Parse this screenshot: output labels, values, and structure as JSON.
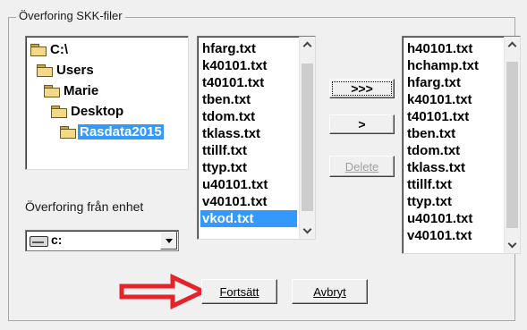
{
  "group": {
    "title": "Överforing SKK-filer"
  },
  "tree": {
    "items": [
      {
        "label": "C:\\",
        "icon": "folder-open-icon"
      },
      {
        "label": "Users",
        "icon": "folder-open-icon"
      },
      {
        "label": "Marie",
        "icon": "folder-open-icon"
      },
      {
        "label": "Desktop",
        "icon": "folder-open-icon"
      },
      {
        "label": "Rasdata2015",
        "icon": "folder-open-icon",
        "selected": true
      }
    ]
  },
  "source_list": {
    "items": [
      "hfarg.txt",
      "k40101.txt",
      "t40101.txt",
      "tben.txt",
      "tdom.txt",
      "tklass.txt",
      "ttillf.txt",
      "ttyp.txt",
      "u40101.txt",
      "v40101.txt",
      "vkod.txt"
    ],
    "selected": "vkod.txt"
  },
  "buttons": {
    "copy_all_label": ">>>",
    "copy_one_label": ">",
    "delete_label": "Delete",
    "continue_label": "Fortsätt",
    "cancel_label": "Avbryt"
  },
  "target_list": {
    "items": [
      "h40101.txt",
      "hchamp.txt",
      "hfarg.txt",
      "k40101.txt",
      "t40101.txt",
      "tben.txt",
      "tdom.txt",
      "tklass.txt",
      "ttillf.txt",
      "ttyp.txt",
      "u40101.txt",
      "v40101.txt"
    ]
  },
  "drive": {
    "label": "Överforing från enhet",
    "value": "c:",
    "icon": "drive-icon"
  },
  "annotation": {
    "icon": "red-arrow-icon",
    "color": "#e3242b"
  },
  "colors": {
    "selection": "#3399ff",
    "background": "#f0f0f0"
  }
}
